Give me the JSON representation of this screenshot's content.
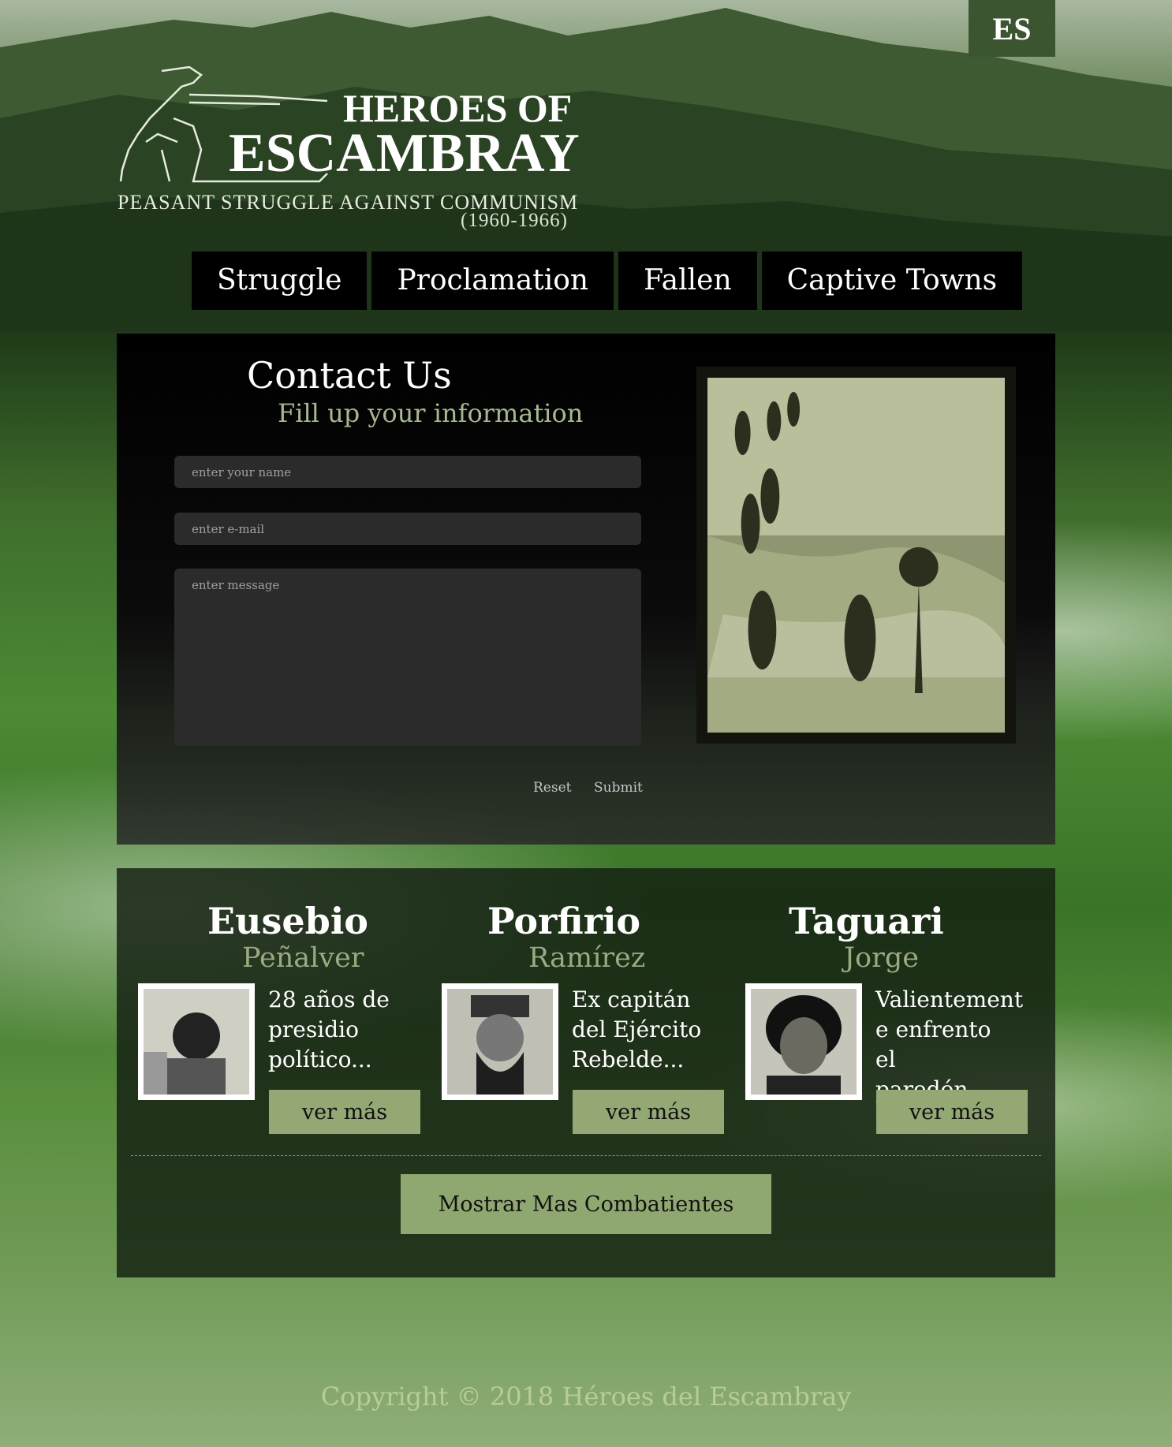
{
  "language_toggle": "ES",
  "logo": {
    "title_line1": "HEROES OF",
    "title_line2": "ESCAMBRAY",
    "tagline": "PEASANT STRUGGLE AGAINST COMMUNISM",
    "years": "(1960-1966)"
  },
  "nav": {
    "items": [
      {
        "label": "Struggle"
      },
      {
        "label": "Proclamation"
      },
      {
        "label": "Fallen"
      },
      {
        "label": "Captive Towns"
      }
    ]
  },
  "contact": {
    "title": "Contact Us",
    "subtitle": "Fill up your information",
    "name_placeholder": "enter your name",
    "email_placeholder": "enter e-mail",
    "message_placeholder": "enter message",
    "reset_label": "Reset",
    "submit_label": "Submit"
  },
  "fighters": [
    {
      "first_name": "Eusebio",
      "last_name": "Peñalver",
      "description": "28 años de presidio político...",
      "button": "ver más"
    },
    {
      "first_name": "Porfirio",
      "last_name": "Ramírez",
      "description": "Ex capitán del Ejército Rebelde...",
      "button": "ver más"
    },
    {
      "first_name": "Taguari",
      "last_name": "Jorge",
      "description": "Valientement e enfrento el paredón....",
      "button": "ver más"
    }
  ],
  "show_more_label": "Mostrar Mas Combatientes",
  "footer": "Copyright © 2018 Héroes del Escambray",
  "colors": {
    "accent_green": "#93a873",
    "lang_bg": "#3b5530",
    "subtitle_green": "#a7b98d"
  }
}
